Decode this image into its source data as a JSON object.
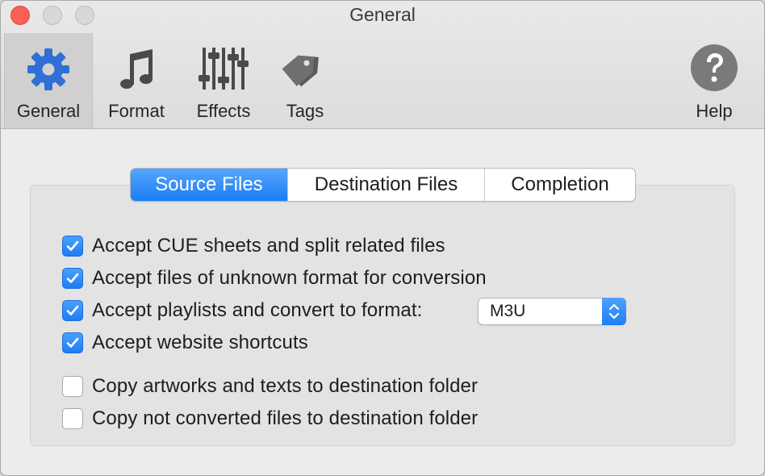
{
  "window": {
    "title": "General"
  },
  "toolbar": {
    "items": [
      {
        "label": "General",
        "icon": "gear-icon",
        "selected": true
      },
      {
        "label": "Format",
        "icon": "music-note-icon",
        "selected": false
      },
      {
        "label": "Effects",
        "icon": "sliders-icon",
        "selected": false
      },
      {
        "label": "Tags",
        "icon": "tag-icon",
        "selected": false
      }
    ],
    "help": {
      "label": "Help",
      "icon": "help-icon"
    }
  },
  "tabs": [
    {
      "label": "Source Files",
      "active": true
    },
    {
      "label": "Destination Files",
      "active": false
    },
    {
      "label": "Completion",
      "active": false
    }
  ],
  "options": [
    {
      "label": "Accept CUE sheets and split related files",
      "checked": true
    },
    {
      "label": "Accept files of unknown format for conversion",
      "checked": true
    },
    {
      "label": "Accept playlists and convert to format:",
      "checked": true
    },
    {
      "label": "Accept website shortcuts",
      "checked": true
    },
    {
      "label": "Copy artworks and texts to destination folder",
      "checked": false
    },
    {
      "label": "Copy not converted files to destination folder",
      "checked": false
    }
  ],
  "playlist_format": {
    "selected": "M3U"
  },
  "colors": {
    "accent": "#1b7cf5",
    "close_button": "#fc5f57",
    "gear_icon": "#2f6fd6"
  }
}
